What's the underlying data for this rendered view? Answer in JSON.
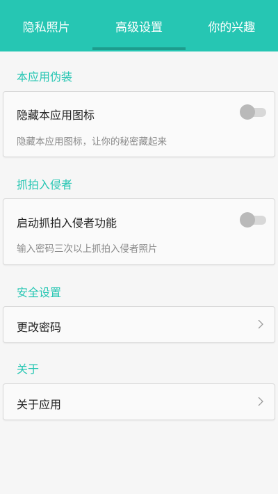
{
  "tabs": [
    {
      "label": "隐私照片",
      "active": false
    },
    {
      "label": "高级设置",
      "active": true
    },
    {
      "label": "你的兴趣",
      "active": false
    }
  ],
  "colors": {
    "accent": "#26c6b3",
    "indicator": "#1d9c8d",
    "background": "#f6f6f6",
    "card": "#fafafa"
  },
  "sections": {
    "disguise": {
      "title": "本应用伪装",
      "item_title": "隐藏本应用图标",
      "item_desc": "隐藏本应用图标，让你的秘密藏起来",
      "toggle_on": false
    },
    "intruder": {
      "title": "抓拍入侵者",
      "item_title": "启动抓拍入侵者功能",
      "item_desc": "输入密码三次以上抓拍入侵者照片",
      "toggle_on": false
    },
    "security": {
      "title": "安全设置",
      "item_title": "更改密码",
      "icon": "chevron-right-icon"
    },
    "about": {
      "title": "关于",
      "item_title": "关于应用",
      "icon": "chevron-right-icon"
    }
  }
}
